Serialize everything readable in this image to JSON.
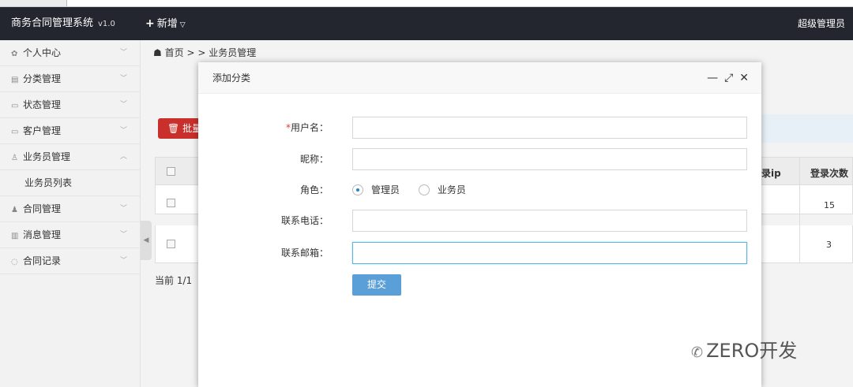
{
  "app": {
    "title": "商务合同管理系统",
    "version": "v1.0",
    "add_menu": "新增",
    "user": "超级管理员"
  },
  "sidebar": {
    "items": [
      {
        "label": "个人中心",
        "icon": "gear-icon"
      },
      {
        "label": "分类管理",
        "icon": "list-icon"
      },
      {
        "label": "状态管理",
        "icon": "card-icon"
      },
      {
        "label": "客户管理",
        "icon": "card-icon"
      },
      {
        "label": "业务员管理",
        "icon": "user-icon",
        "expanded": true
      },
      {
        "label": "业务员列表",
        "sub": true
      },
      {
        "label": "合同管理",
        "icon": "person-icon"
      },
      {
        "label": "消息管理",
        "icon": "message-icon"
      },
      {
        "label": "合同记录",
        "icon": "chat-icon"
      }
    ]
  },
  "breadcrumb": {
    "home": "首页",
    "sep1": ">",
    "sep2": ">",
    "current": "业务员管理"
  },
  "list": {
    "batch_label": "批量",
    "headers": {
      "login_ip": "录ip",
      "login_count": "登录次数"
    },
    "rows": [
      {
        "login_count": "15"
      },
      {
        "login_count": "3"
      }
    ],
    "pager": "当前 1/1 "
  },
  "modal": {
    "title": "添加分类",
    "fields": {
      "username": {
        "label": "用户名：",
        "required_mark": "*",
        "value": ""
      },
      "nickname": {
        "label": "昵称：",
        "value": ""
      },
      "role": {
        "label": "角色：",
        "options": [
          "管理员",
          "业务员"
        ],
        "selected": "管理员"
      },
      "phone": {
        "label": "联系电话：",
        "value": ""
      },
      "email": {
        "label": "联系邮箱：",
        "value": ""
      }
    },
    "submit": "提交"
  },
  "watermark": "ZERO开发",
  "colors": {
    "topbar": "#23262e",
    "primary": "#5a9fd8",
    "danger": "#c9302c",
    "radio_on": "#1e88c7"
  }
}
